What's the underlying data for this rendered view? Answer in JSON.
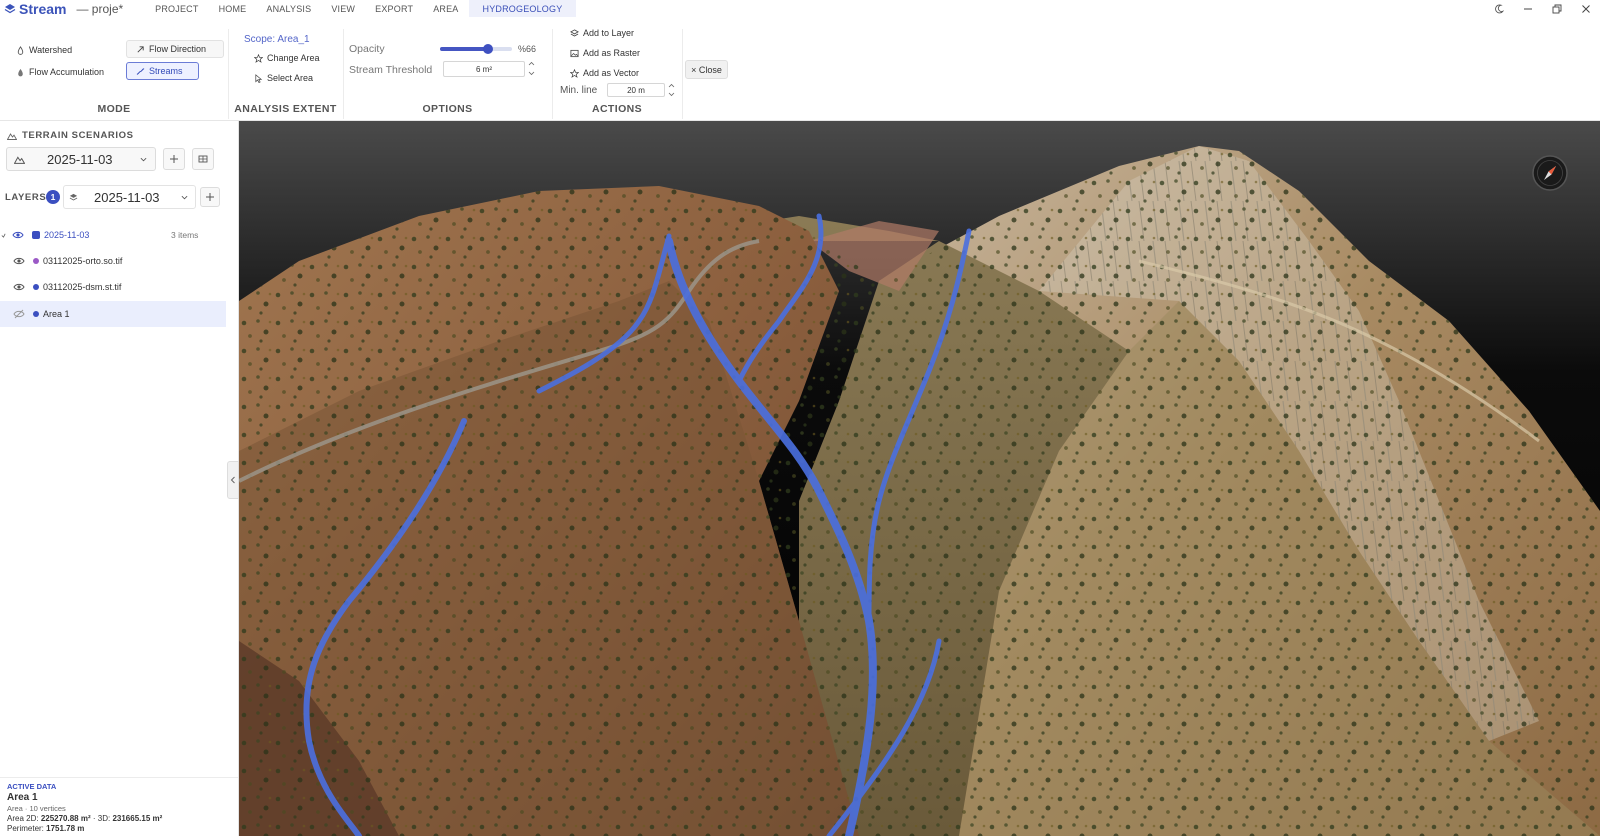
{
  "app": {
    "name": "Stream",
    "project": "— proje*",
    "menu": [
      "PROJECT",
      "HOME",
      "ANALYSIS",
      "VIEW",
      "EXPORT",
      "AREA",
      "HYDROGEOLOGY"
    ],
    "active_menu": "HYDROGEOLOGY"
  },
  "ribbon": {
    "mode": {
      "title": "MODE",
      "watershed": "Watershed",
      "flow_direction": "Flow Direction",
      "flow_accumulation": "Flow Accumulation",
      "streams": "Streams",
      "selected": "Streams"
    },
    "extent": {
      "title": "ANALYSIS EXTENT",
      "scope": "Scope: Area_1",
      "change_area": "Change Area",
      "select_area": "Select Area"
    },
    "options": {
      "title": "OPTIONS",
      "opacity_label": "Opacity",
      "opacity_value": "%66",
      "opacity_fraction": 0.66,
      "threshold_label": "Stream Threshold",
      "threshold_value": "6 m²"
    },
    "actions": {
      "title": "ACTIONS",
      "add_to_layer": "Add to Layer",
      "add_as_raster": "Add as Raster",
      "add_as_vector": "Add as Vector",
      "min_line_label": "Min. line",
      "min_line_value": "20 m"
    },
    "close_label": "× Close"
  },
  "left_panel": {
    "terrain_title": "TERRAIN SCENARIOS",
    "terrain_selected": "2025-11-03",
    "layers_title": "LAYERS",
    "layers_count": "1",
    "layers_selected": "2025-11-03",
    "layers": [
      {
        "name": "2025-11-03",
        "meta": "3 items",
        "color": "#3b4fc0",
        "group": true
      },
      {
        "name": "03112025-orto.so.tif",
        "meta": "",
        "color": "#9b59c6"
      },
      {
        "name": "03112025-dsm.st.tif",
        "meta": "",
        "color": "#3b4fc0"
      },
      {
        "name": "Area 1",
        "meta": "",
        "color": "#3b4fc0",
        "selected": true
      }
    ],
    "active_data": {
      "heading": "ACTIVE DATA",
      "name": "Area 1",
      "detail": "Area · 10 vertices",
      "area_2d_label": "Area 2D:",
      "area_2d": "225270.88 m²",
      "area_3d_label": "· 3D:",
      "area_3d": "231665.15 m²",
      "perimeter_label": "Perimeter:",
      "perimeter": "1751.78 m"
    }
  },
  "colors": {
    "accent": "#3b4fc0",
    "stream": "#4a6fe0",
    "terrain_brown": "#8a5a3c",
    "terrain_tan": "#b89868"
  },
  "icons": [
    "logo-icon",
    "watershed-icon",
    "flow-direction-icon",
    "flow-accumulation-icon",
    "streams-icon",
    "star-icon",
    "cursor-icon",
    "layer-stack-icon",
    "raster-icon",
    "vector-icon",
    "terrain-icon",
    "plus-icon",
    "grid-icon",
    "eye-icon",
    "eye-off-icon",
    "compass-icon",
    "moon-icon",
    "minimize-icon",
    "restore-icon",
    "close-icon"
  ]
}
